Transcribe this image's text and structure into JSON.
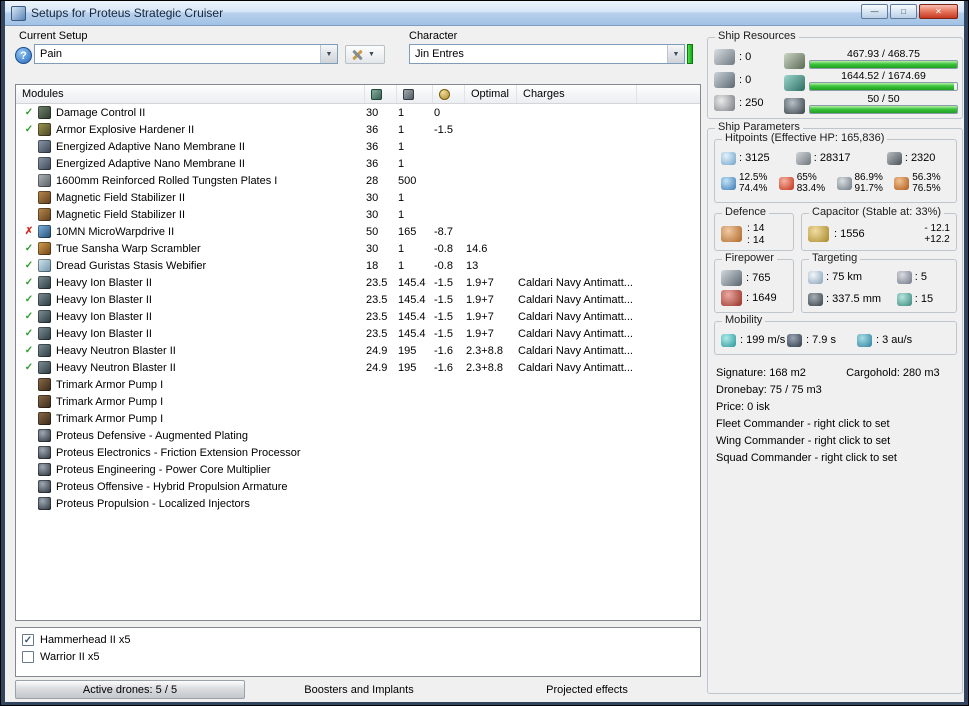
{
  "window": {
    "title": "Setups for Proteus Strategic Cruiser"
  },
  "icons": {
    "check": "✓",
    "cross": "✗",
    "dropdown": "▼",
    "help": "?",
    "minimize": "—",
    "maximize": "□",
    "close": "✕"
  },
  "current_setup": {
    "label": "Current Setup",
    "value": "Pain"
  },
  "character": {
    "label": "Character",
    "value": "Jin Entres"
  },
  "modules_table": {
    "title": "Modules",
    "columns": {
      "optimal": "Optimal",
      "charges": "Charges"
    },
    "rows": [
      {
        "state": "on",
        "icon": "damage-control-icon",
        "name": "Damage Control II",
        "cpu": "30",
        "pg": "1",
        "cap": "0",
        "optimal": "",
        "charges": ""
      },
      {
        "state": "on",
        "icon": "armor-hardener-icon",
        "name": "Armor Explosive Hardener II",
        "cpu": "36",
        "pg": "1",
        "cap": "-1.5",
        "optimal": "",
        "charges": ""
      },
      {
        "state": "",
        "icon": "nano-membrane-icon",
        "name": "Energized Adaptive Nano Membrane II",
        "cpu": "36",
        "pg": "1",
        "cap": "",
        "optimal": "",
        "charges": ""
      },
      {
        "state": "",
        "icon": "nano-membrane-icon",
        "name": "Energized Adaptive Nano Membrane II",
        "cpu": "36",
        "pg": "1",
        "cap": "",
        "optimal": "",
        "charges": ""
      },
      {
        "state": "",
        "icon": "armor-plate-icon",
        "name": "1600mm Reinforced Rolled Tungsten Plates I",
        "cpu": "28",
        "pg": "500",
        "cap": "",
        "optimal": "",
        "charges": ""
      },
      {
        "state": "",
        "icon": "magnetic-field-stabilizer-icon",
        "name": "Magnetic Field Stabilizer II",
        "cpu": "30",
        "pg": "1",
        "cap": "",
        "optimal": "",
        "charges": ""
      },
      {
        "state": "",
        "icon": "magnetic-field-stabilizer-icon",
        "name": "Magnetic Field Stabilizer II",
        "cpu": "30",
        "pg": "1",
        "cap": "",
        "optimal": "",
        "charges": ""
      },
      {
        "state": "off",
        "icon": "microwarpdrive-icon",
        "name": "10MN MicroWarpdrive II",
        "cpu": "50",
        "pg": "165",
        "cap": "-8.7",
        "optimal": "",
        "charges": ""
      },
      {
        "state": "on",
        "icon": "warp-scrambler-icon",
        "name": "True Sansha Warp Scrambler",
        "cpu": "30",
        "pg": "1",
        "cap": "-0.8",
        "optimal": "14.6",
        "charges": ""
      },
      {
        "state": "on",
        "icon": "stasis-webifier-icon",
        "name": "Dread Guristas Stasis Webifier",
        "cpu": "18",
        "pg": "1",
        "cap": "-0.8",
        "optimal": "13",
        "charges": ""
      },
      {
        "state": "on",
        "icon": "hybrid-turret-icon",
        "name": "Heavy Ion Blaster II",
        "cpu": "23.5",
        "pg": "145.4",
        "cap": "-1.5",
        "optimal": "1.9+7",
        "charges": "Caldari Navy Antimatt..."
      },
      {
        "state": "on",
        "icon": "hybrid-turret-icon",
        "name": "Heavy Ion Blaster II",
        "cpu": "23.5",
        "pg": "145.4",
        "cap": "-1.5",
        "optimal": "1.9+7",
        "charges": "Caldari Navy Antimatt..."
      },
      {
        "state": "on",
        "icon": "hybrid-turret-icon",
        "name": "Heavy Ion Blaster II",
        "cpu": "23.5",
        "pg": "145.4",
        "cap": "-1.5",
        "optimal": "1.9+7",
        "charges": "Caldari Navy Antimatt..."
      },
      {
        "state": "on",
        "icon": "hybrid-turret-icon",
        "name": "Heavy Ion Blaster II",
        "cpu": "23.5",
        "pg": "145.4",
        "cap": "-1.5",
        "optimal": "1.9+7",
        "charges": "Caldari Navy Antimatt..."
      },
      {
        "state": "on",
        "icon": "hybrid-turret-icon",
        "name": "Heavy Neutron Blaster II",
        "cpu": "24.9",
        "pg": "195",
        "cap": "-1.6",
        "optimal": "2.3+8.8",
        "charges": "Caldari Navy Antimatt..."
      },
      {
        "state": "on",
        "icon": "hybrid-turret-icon",
        "name": "Heavy Neutron Blaster II",
        "cpu": "24.9",
        "pg": "195",
        "cap": "-1.6",
        "optimal": "2.3+8.8",
        "charges": "Caldari Navy Antimatt..."
      },
      {
        "state": "",
        "icon": "armor-rig-icon",
        "name": "Trimark Armor Pump I",
        "cpu": "",
        "pg": "",
        "cap": "",
        "optimal": "",
        "charges": ""
      },
      {
        "state": "",
        "icon": "armor-rig-icon",
        "name": "Trimark Armor Pump I",
        "cpu": "",
        "pg": "",
        "cap": "",
        "optimal": "",
        "charges": ""
      },
      {
        "state": "",
        "icon": "armor-rig-icon",
        "name": "Trimark Armor Pump I",
        "cpu": "",
        "pg": "",
        "cap": "",
        "optimal": "",
        "charges": ""
      },
      {
        "state": "",
        "icon": "subsystem-icon",
        "name": "Proteus Defensive - Augmented Plating",
        "cpu": "",
        "pg": "",
        "cap": "",
        "optimal": "",
        "charges": ""
      },
      {
        "state": "",
        "icon": "subsystem-icon",
        "name": "Proteus Electronics - Friction Extension Processor",
        "cpu": "",
        "pg": "",
        "cap": "",
        "optimal": "",
        "charges": ""
      },
      {
        "state": "",
        "icon": "subsystem-icon",
        "name": "Proteus Engineering - Power Core Multiplier",
        "cpu": "",
        "pg": "",
        "cap": "",
        "optimal": "",
        "charges": ""
      },
      {
        "state": "",
        "icon": "subsystem-icon",
        "name": "Proteus Offensive - Hybrid Propulsion Armature",
        "cpu": "",
        "pg": "",
        "cap": "",
        "optimal": "",
        "charges": ""
      },
      {
        "state": "",
        "icon": "subsystem-icon",
        "name": "Proteus Propulsion - Localized Injectors",
        "cpu": "",
        "pg": "",
        "cap": "",
        "optimal": "",
        "charges": ""
      }
    ]
  },
  "drones": {
    "items": [
      {
        "checked": true,
        "label": "Hammerhead II x5"
      },
      {
        "checked": false,
        "label": "Warrior II x5"
      }
    ]
  },
  "tabs": [
    "Active drones: 5 / 5",
    "Boosters and Implants",
    "Projected effects"
  ],
  "ship_resources": {
    "title": "Ship Resources",
    "slots": [
      {
        "icon": "turret-hardpoints-icon",
        "value": ": 0"
      },
      {
        "icon": "launcher-hardpoints-icon",
        "value": ": 0"
      },
      {
        "icon": "calibration-icon",
        "value": ": 250"
      }
    ],
    "bars": [
      {
        "icon": "powergrid-icon",
        "text": "467.93 / 468.75",
        "pct": 99.8
      },
      {
        "icon": "cpu-icon",
        "text": "1644.52 / 1674.69",
        "pct": 98.2
      },
      {
        "icon": "drone-bandwidth-icon",
        "text": "50 / 50",
        "pct": 100
      }
    ]
  },
  "ship_parameters": {
    "title": "Ship Parameters",
    "hitpoints": {
      "title": "Hitpoints (Effective HP: 165,836)",
      "pools": [
        {
          "icon": "shield-icon",
          "value": ": 3125"
        },
        {
          "icon": "armor-icon",
          "value": ": 28317"
        },
        {
          "icon": "structure-icon",
          "value": ": 2320"
        }
      ],
      "resists": [
        {
          "icon": "em-resist-icon",
          "shield": "12.5%",
          "armor": "74.4%"
        },
        {
          "icon": "thermal-resist-icon",
          "shield": "65%",
          "armor": "83.4%"
        },
        {
          "icon": "kinetic-resist-icon",
          "shield": "86.9%",
          "armor": "91.7%"
        },
        {
          "icon": "explosive-resist-icon",
          "shield": "56.3%",
          "armor": "76.5%"
        }
      ]
    },
    "defence": {
      "title": "Defence",
      "values": [
        ": 14",
        ": 14"
      ]
    },
    "capacitor": {
      "title": "Capacitor (Stable at: 33%)",
      "amount": ": 1556",
      "delta_out": "- 12.1",
      "delta_in": "+12.2"
    },
    "firepower": {
      "title": "Firepower",
      "rows": [
        {
          "icon": "volley-icon",
          "value": ": 765"
        },
        {
          "icon": "dps-icon",
          "value": ": 1649"
        }
      ]
    },
    "targeting": {
      "title": "Targeting",
      "cells": [
        {
          "icon": "target-range-icon",
          "value": ": 75 km"
        },
        {
          "icon": "max-targets-icon",
          "value": ": 5"
        },
        {
          "icon": "scan-resolution-icon",
          "value": ": 337.5 mm"
        },
        {
          "icon": "sensor-strength-icon",
          "value": ": 15"
        }
      ]
    },
    "mobility": {
      "title": "Mobility",
      "cells": [
        {
          "icon": "speed-icon",
          "value": ": 199 m/s"
        },
        {
          "icon": "align-time-icon",
          "value": ": 7.9 s"
        },
        {
          "icon": "warp-speed-icon",
          "value": ": 3 au/s"
        }
      ]
    },
    "info": {
      "signature": "Signature: 168 m2",
      "cargohold": "Cargohold: 280 m3",
      "dronebay": "Dronebay: 75 / 75 m3",
      "price": "Price: 0 isk",
      "fleet": "Fleet Commander - right click to set",
      "wing": "Wing Commander - right click to set",
      "squad": "Squad Commander - right click to set"
    }
  }
}
